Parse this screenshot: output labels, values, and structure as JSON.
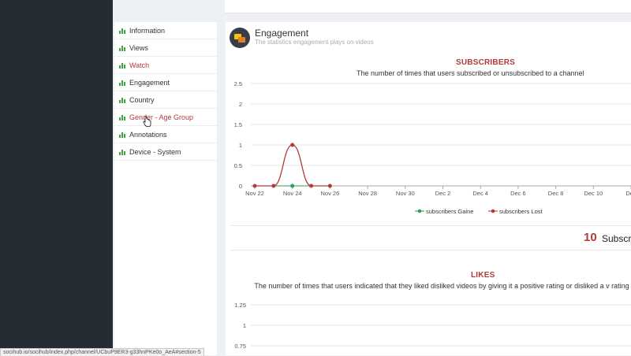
{
  "nav": {
    "items": [
      {
        "label": "Information"
      },
      {
        "label": "Views"
      },
      {
        "label": "Watch"
      },
      {
        "label": "Engagement"
      },
      {
        "label": "Country"
      },
      {
        "label": "Gender - Age Group"
      },
      {
        "label": "Annotations"
      },
      {
        "label": "Device - System"
      }
    ],
    "highlight_color": "#b33a3a",
    "icon_color": "#3fa33f"
  },
  "engagement": {
    "title": "Engagement",
    "subtitle": "The statistics engagement plays on videos"
  },
  "subscribers_chart": {
    "title": "SUBSCRIBERS",
    "subtitle": "The number of times that users subscribed or unsubscribed to a channel",
    "total_count": "10",
    "total_label": "Subscri"
  },
  "likes_chart": {
    "title": "LIKES",
    "subtitle": "The number of times that users indicated that they liked disliked videos by giving it a positive rating or disliked a v rating"
  },
  "status_bar": {
    "url": "socihub.io/socihub/index.php/channel/UCbuP9ER3-g33hnPKe0o_AeA#section-5"
  },
  "chart_data": [
    {
      "type": "line",
      "title": "SUBSCRIBERS",
      "subtitle": "The number of times that users subscribed or unsubscribed to a channel",
      "ylim": [
        0,
        2.5
      ],
      "y_ticks": [
        "0",
        "0.5",
        "1",
        "1.5",
        "2",
        "2.5"
      ],
      "x_ticks": [
        "Nov 22",
        "Nov 24",
        "Nov 26",
        "Nov 28",
        "Nov 30",
        "Dec 2",
        "Dec 4",
        "Dec 6",
        "Dec 8",
        "Dec 10",
        "Dec"
      ],
      "grid": true,
      "legend_position": "bottom",
      "series": [
        {
          "name": "subscribers Gaine",
          "color": "#2e9e5b",
          "points": [
            {
              "x": "Nov 22",
              "y": 0
            },
            {
              "x": "Nov 23",
              "y": 0
            },
            {
              "x": "Nov 24",
              "y": 0
            },
            {
              "x": "Nov 25",
              "y": 0
            },
            {
              "x": "Nov 26",
              "y": 0
            }
          ]
        },
        {
          "name": "subscribers Lost",
          "color": "#b33a3a",
          "points": [
            {
              "x": "Nov 22",
              "y": 0
            },
            {
              "x": "Nov 23",
              "y": 0
            },
            {
              "x": "Nov 24",
              "y": 1
            },
            {
              "x": "Nov 25",
              "y": 0
            },
            {
              "x": "Nov 26",
              "y": 0
            }
          ]
        }
      ]
    },
    {
      "type": "line",
      "title": "LIKES",
      "subtitle": "The number of times that users indicated that they liked disliked videos by giving it a positive rating or disliked a v rating",
      "y_ticks": [
        "0.75",
        "1",
        "1.25"
      ],
      "grid": true,
      "series": []
    }
  ]
}
